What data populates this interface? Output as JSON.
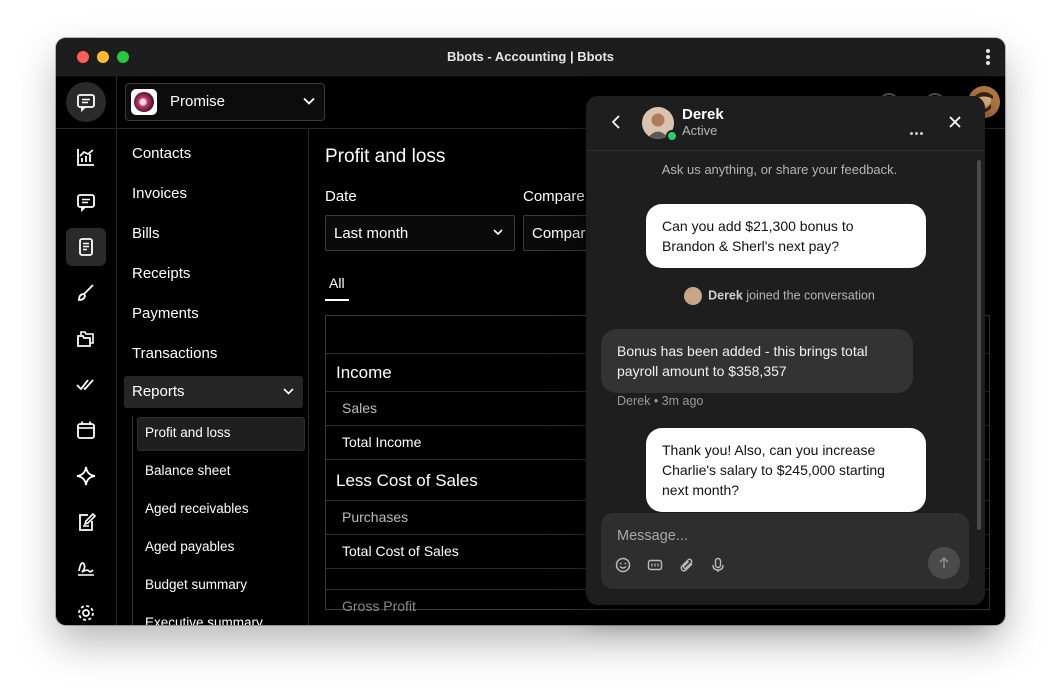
{
  "window": {
    "title": "Bbots - Accounting | Bbots"
  },
  "org": {
    "name": "Promise"
  },
  "rail": {
    "icons": [
      "chat-icon",
      "chart-icon",
      "message-icon",
      "document-icon",
      "brush-icon",
      "folders-icon",
      "check-double-icon",
      "calendar-icon",
      "sparkle-icon",
      "edit-note-icon",
      "signature-icon",
      "gear-icon"
    ]
  },
  "nav": {
    "items": [
      "Contacts",
      "Invoices",
      "Bills",
      "Receipts",
      "Payments",
      "Transactions"
    ],
    "reports_label": "Reports",
    "sub_items": [
      "Profit and loss",
      "Balance sheet",
      "Aged receivables",
      "Aged payables",
      "Budget summary",
      "Executive summary"
    ]
  },
  "report": {
    "title": "Profit and loss",
    "date_label": "Date",
    "date_value": "Last month",
    "compare_label": "Compare",
    "compare_value": "Compar",
    "tab_all": "All",
    "rows": [
      "Income",
      "Sales",
      "Total Income",
      "Less Cost of Sales",
      "Purchases",
      "Total Cost of Sales",
      "Gross Profit"
    ]
  },
  "chat": {
    "agent_name": "Derek",
    "agent_status": "Active",
    "intro": "Ask us anything, or share your feedback.",
    "messages": [
      {
        "from": "me",
        "text": "Can you add $21,300 bonus to Brandon & Sherl's next pay?"
      },
      {
        "from": "system",
        "name": "Derek",
        "text": "joined the conversation"
      },
      {
        "from": "agent",
        "text": "Bonus has been added - this brings total payroll amount to $358,357",
        "meta": "Derek • 3m ago"
      },
      {
        "from": "me",
        "text": "Thank you! Also, can you increase Charlie's salary to $245,000 starting next month?"
      }
    ],
    "composer_placeholder": "Message..."
  },
  "colors": {
    "background": "#000000",
    "panel": "#1e1e1e",
    "bubble_me": "#ffffff",
    "bubble_agent": "#333333",
    "online": "#2ecc71"
  }
}
